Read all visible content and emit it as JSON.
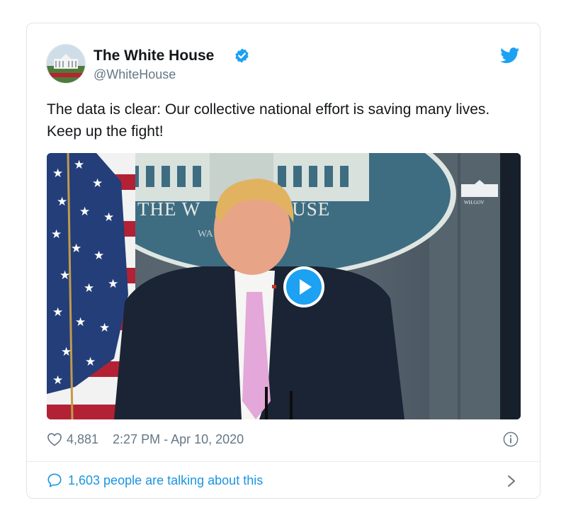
{
  "tweet": {
    "author_name": "The White House",
    "author_handle": "@WhiteHouse",
    "verified": true,
    "text": "The data is clear: Our collective national effort is saving many lives. Keep up the fight!",
    "likes": "4,881",
    "timestamp": "2:27 PM - Apr 10, 2020",
    "talking": "1,603 people are talking about this"
  },
  "media": {
    "seal_text": "THE W              OUSE",
    "seal_subtext": "WA",
    "watermark": "WH.GOV"
  },
  "icons": {
    "verified": "verified-badge-icon",
    "logo": "twitter-bird-icon",
    "like": "heart-icon",
    "info": "info-icon",
    "reply": "speech-bubble-icon",
    "more": "chevron-right-icon",
    "play": "play-icon"
  },
  "colors": {
    "accent": "#1da1f2",
    "link": "#1b95e0",
    "secondary_text": "#657786",
    "border": "#dfe3e6"
  }
}
